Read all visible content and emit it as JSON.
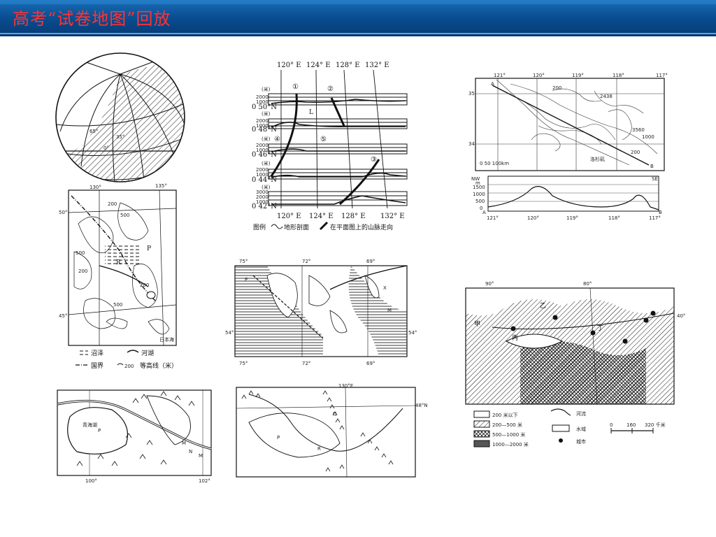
{
  "header": {
    "title": "高考“试卷地图”回放"
  },
  "globe": {
    "labels": [
      "65°",
      "35°",
      "0°"
    ]
  },
  "profile": {
    "top_lon": [
      "120° E",
      "124° E",
      "128° E",
      "132° E"
    ],
    "bottom_lon": [
      "120° E",
      "124° E",
      "128° E",
      "132° E"
    ],
    "unit": "(米)",
    "rows": [
      {
        "lat": "0 50°N",
        "ticks": [
          "2000",
          "1000"
        ]
      },
      {
        "lat": "0 48°N",
        "ticks": [
          "2000",
          "1000"
        ]
      },
      {
        "lat": "0 46°N",
        "ticks": [
          "2000",
          "1000"
        ]
      },
      {
        "lat": "0 44°N",
        "ticks": [
          "2000",
          "1000"
        ]
      },
      {
        "lat": "0 42°N",
        "ticks": [
          "3000",
          "2000",
          "1000"
        ]
      }
    ],
    "markers": [
      "①",
      "②",
      "③",
      "④",
      "⑤"
    ],
    "letter": "L",
    "legend": {
      "prefix": "图例",
      "item1": "地形剖面",
      "item2": "在平面图上的山脉走向"
    }
  },
  "us_map": {
    "lon": [
      "121°",
      "120°",
      "119°",
      "118°",
      "117°"
    ],
    "lat": [
      "35°",
      "34°"
    ],
    "points": [
      "A",
      "B"
    ],
    "labels": [
      "200",
      "2438",
      "3560",
      "1000",
      "200",
      "洛杉矶"
    ],
    "scale": "0  50  100km",
    "prof_nw": "NW",
    "prof_se": "SE",
    "prof_unit": "m",
    "prof_ticks": [
      "1500",
      "1000",
      "500",
      "0"
    ],
    "prof_lon": [
      "121°",
      "120°",
      "119°",
      "118°",
      "117°"
    ],
    "prof_a": "A",
    "prof_b": "B"
  },
  "ne_map": {
    "top_lon": [
      "130°",
      "135°"
    ],
    "lat": [
      "50°",
      "45°"
    ],
    "contours": [
      "200",
      "500",
      "500",
      "200",
      "200",
      "500"
    ],
    "letters": [
      "P",
      "R"
    ],
    "lake": "日本海",
    "legend": {
      "marsh": "沼泽",
      "lake": "河湖",
      "border": "国界",
      "contour": "等高线（米）",
      "contour_num": "200"
    }
  },
  "sea_map": {
    "top_lon": [
      "75°",
      "72°",
      "69°"
    ],
    "bottom_lon": [
      "75°",
      "72°",
      "69°"
    ],
    "lat_left": "54°",
    "lat_right": "54°",
    "letters": [
      "P",
      "X",
      "M"
    ]
  },
  "qh_map": {
    "lake": "青海湖",
    "letters": [
      "P",
      "M",
      "N",
      "M"
    ],
    "lon": [
      "100°",
      "102°"
    ]
  },
  "ne2_map": {
    "lon": "130°E",
    "lat": "48°N",
    "letters": [
      "P",
      "R",
      "Q"
    ]
  },
  "cn_map": {
    "lon": [
      "90°",
      "80°"
    ],
    "lat": "40°",
    "places": [
      "乙",
      "甲",
      "丙",
      "丁"
    ],
    "legend": [
      "200 米以下",
      "200—500 米",
      "500—1000 米",
      "1000—2000 米"
    ],
    "legend2": [
      "河流",
      "水域",
      "城市"
    ],
    "scale": [
      "0",
      "160",
      "320 千米"
    ]
  }
}
